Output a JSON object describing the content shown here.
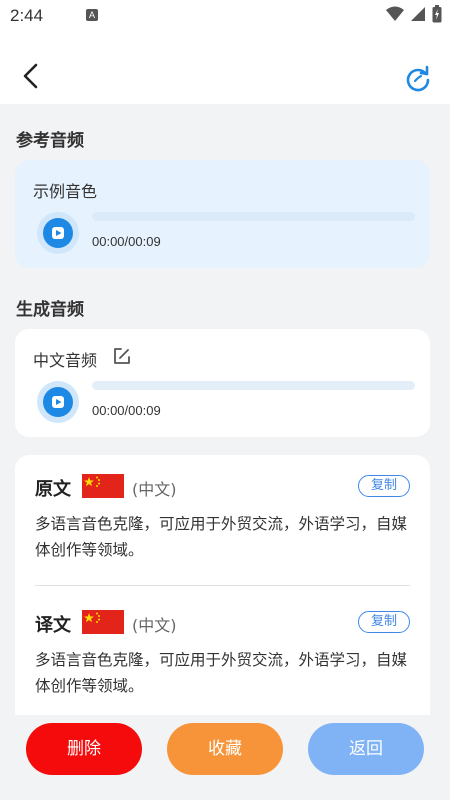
{
  "status_bar": {
    "time": "2:44",
    "notification_badge": "A"
  },
  "header": {
    "back_icon": "chevron-left-icon",
    "refresh_icon": "refresh-icon"
  },
  "reference": {
    "section_title": "参考音频",
    "card_label": "示例音色",
    "time": "00:00/00:09",
    "progress": 0
  },
  "generated": {
    "section_title": "生成音频",
    "card_label": "中文音频",
    "edit_icon": "edit-icon",
    "time": "00:00/00:09",
    "progress": 0
  },
  "original": {
    "title": "原文",
    "language": "(中文)",
    "copy_label": "复制",
    "text": "多语言音色克隆，可应用于外贸交流，外语学习，自媒体创作等领域。"
  },
  "translation": {
    "title": "译文",
    "language": "(中文)",
    "copy_label": "复制",
    "text": "多语言音色克隆，可应用于外贸交流，外语学习，自媒体创作等领域。"
  },
  "actions": {
    "delete_label": "删除",
    "favorite_label": "收藏",
    "back_label": "返回"
  },
  "colors": {
    "accent": "#1e88e5",
    "delete": "#f50b0b",
    "favorite": "#f7943a",
    "back": "#7fb3f5"
  }
}
